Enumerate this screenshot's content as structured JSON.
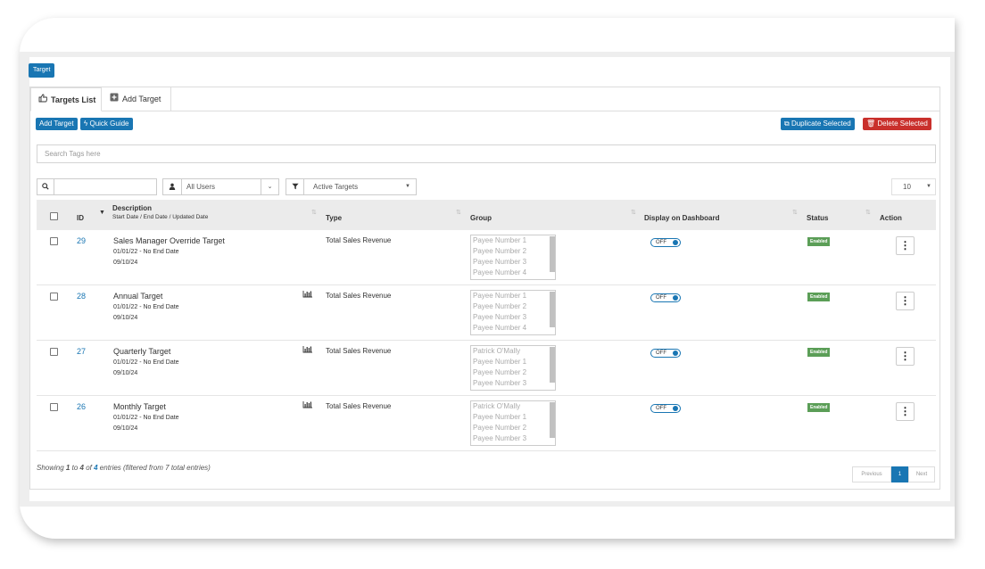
{
  "app": {
    "brand": "Target"
  },
  "tabs": [
    {
      "label": "Targets List",
      "icon": "thumbs-up-icon",
      "active": true
    },
    {
      "label": "Add Target",
      "icon": "plus-square-icon",
      "active": false
    }
  ],
  "toolbar": {
    "add_target": "Add Target",
    "quick_guide": "Quick Guide",
    "duplicate_selected": "Duplicate Selected",
    "delete_selected": "Delete Selected"
  },
  "search_tags": {
    "placeholder": "Search Tags here"
  },
  "filters": {
    "users_selected": "All Users",
    "targets_selected": "Active Targets",
    "page_size": "10"
  },
  "table": {
    "headers": {
      "id": "ID",
      "description": "Description",
      "description_sub": "Start Date / End Date / Updated Date",
      "type": "Type",
      "group": "Group",
      "display": "Display on Dashboard",
      "status": "Status",
      "action": "Action"
    },
    "rows": [
      {
        "id": "29",
        "name": "Sales Manager Override Target",
        "dates": "01/01/22 - No End Date",
        "updated": "09/10/24",
        "has_chart": false,
        "type": "Total Sales Revenue",
        "group": [
          "Payee Number 1",
          "Payee Number 2",
          "Payee Number 3",
          "Payee Number 4"
        ],
        "display": "OFF",
        "status": "Enabled"
      },
      {
        "id": "28",
        "name": "Annual Target",
        "dates": "01/01/22 - No End Date",
        "updated": "09/10/24",
        "has_chart": true,
        "type": "Total Sales Revenue",
        "group": [
          "Payee Number 1",
          "Payee Number 2",
          "Payee Number 3",
          "Payee Number 4"
        ],
        "display": "OFF",
        "status": "Enabled"
      },
      {
        "id": "27",
        "name": "Quarterly Target",
        "dates": "01/01/22 - No End Date",
        "updated": "09/10/24",
        "has_chart": true,
        "type": "Total Sales Revenue",
        "group": [
          "Patrick O'Mally",
          "Payee Number 1",
          "Payee Number 2",
          "Payee Number 3"
        ],
        "display": "OFF",
        "status": "Enabled"
      },
      {
        "id": "26",
        "name": "Monthly Target",
        "dates": "01/01/22 - No End Date",
        "updated": "09/10/24",
        "has_chart": true,
        "type": "Total Sales Revenue",
        "group": [
          "Patrick O'Mally",
          "Payee Number 1",
          "Payee Number 2",
          "Payee Number 3"
        ],
        "display": "OFF",
        "status": "Enabled"
      }
    ]
  },
  "footer": {
    "showing": "Showing",
    "from": "1",
    "to_word": "to",
    "to": "4",
    "of_word": "of",
    "total": "4",
    "rest": "entries (filtered from 7 total entries)"
  },
  "pagination": {
    "previous": "Previous",
    "current": "1",
    "next": "Next"
  },
  "colors": {
    "primary": "#1976b3",
    "danger": "#c9302c",
    "success": "#5b9e57"
  }
}
